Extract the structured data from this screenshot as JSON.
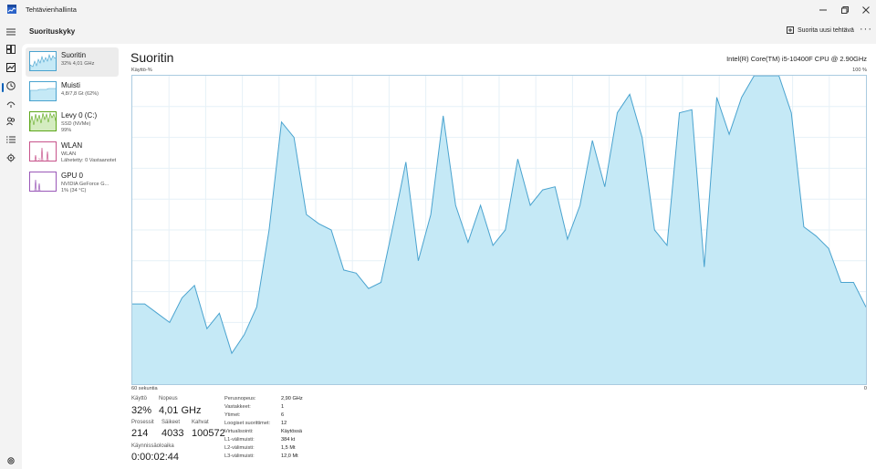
{
  "window": {
    "title": "Tehtävienhallinta",
    "minimize_icon": "minimize-icon",
    "maximize_icon": "restore-icon",
    "close_icon": "close-icon"
  },
  "header": {
    "section_title": "Suorituskyky",
    "run_task_label": "Suorita uusi tehtävä",
    "more_label": "···"
  },
  "rail": {
    "items": [
      {
        "icon": "hamburger-menu-icon"
      },
      {
        "icon": "processes-icon"
      },
      {
        "icon": "performance-icon"
      },
      {
        "icon": "app-history-icon"
      },
      {
        "icon": "startup-apps-icon"
      },
      {
        "icon": "users-icon"
      },
      {
        "icon": "details-icon"
      },
      {
        "icon": "services-icon"
      },
      {
        "icon": "settings-gear-icon"
      }
    ],
    "accent_color": "#005fb8"
  },
  "devices": [
    {
      "name": "Suoritin",
      "sub": "32% 4,01 GHz",
      "sub2": "",
      "color": "#4aa3cf"
    },
    {
      "name": "Muisti",
      "sub": "4,8/7,8 Gt (62%)",
      "sub2": "",
      "color": "#4aa3cf"
    },
    {
      "name": "Levy 0 (C:)",
      "sub": "SSD (NVMe)",
      "sub2": "99%",
      "color": "#5da71a"
    },
    {
      "name": "WLAN",
      "sub": "WLAN",
      "sub2": "Lähetetty: 0 Vastaanotet",
      "color": "#c7538b"
    },
    {
      "name": "GPU 0",
      "sub": "NVIDIA GeForce G...",
      "sub2": "1% (34 °C)",
      "color": "#9a58b8"
    }
  ],
  "perf": {
    "title": "Suoritin",
    "cpu_model": "Intel(R) Core(TM) i5-10400F CPU @ 2.90GHz",
    "y_axis_label": "Käyttö-%",
    "y_max_label": "100 %",
    "x_left_label": "60 sekuntia",
    "x_right_label": "0"
  },
  "chart_data": {
    "type": "area",
    "ylim": [
      0,
      100
    ],
    "grid": true,
    "color": "#4aa3cf",
    "fill": "#c5e9f6",
    "x": [
      0,
      1,
      2,
      3,
      4,
      5,
      6,
      7,
      8,
      9,
      10,
      11,
      12,
      13,
      14,
      15,
      16,
      17,
      18,
      19,
      20,
      21,
      22,
      23,
      24,
      25,
      26,
      27,
      28,
      29,
      30,
      31,
      32,
      33,
      34,
      35,
      36,
      37,
      38,
      39,
      40,
      41,
      42,
      43,
      44,
      45,
      46,
      47,
      48,
      49,
      50,
      51,
      52,
      53,
      54,
      55,
      56,
      57,
      58,
      59
    ],
    "values": [
      26,
      26,
      23,
      20,
      28,
      32,
      18,
      23,
      10,
      16,
      25,
      50,
      85,
      80,
      55,
      52,
      50,
      37,
      36,
      31,
      33,
      52,
      72,
      40,
      55,
      87,
      58,
      46,
      58,
      45,
      50,
      73,
      58,
      63,
      64,
      47,
      58,
      79,
      64,
      88,
      94,
      80,
      50,
      45,
      88,
      89,
      38,
      93,
      81,
      93,
      100,
      100,
      100,
      88,
      51,
      48,
      44,
      33,
      33,
      25
    ],
    "x_range_label": "60 sekuntia"
  },
  "stats": {
    "usage_label": "Käyttö",
    "usage_value": "32%",
    "speed_label": "Nopeus",
    "speed_value": "4,01 GHz",
    "processes_label": "Prosessit",
    "processes_value": "214",
    "threads_label": "Säikeet",
    "threads_value": "4033",
    "handles_label": "Kahvat",
    "handles_value": "100572",
    "uptime_label": "Käynnissäoloaika",
    "uptime_value": "0:00:02:44",
    "details": [
      {
        "k": "Perusnopeus:",
        "v": "2,90 GHz"
      },
      {
        "k": "Vastakkeet:",
        "v": "1"
      },
      {
        "k": "Ytimet:",
        "v": "6"
      },
      {
        "k": "Loogiset suorittimet:",
        "v": "12"
      },
      {
        "k": "Virtualisointi:",
        "v": "Käytössä"
      },
      {
        "k": "L1-välimuisti:",
        "v": "384 kt"
      },
      {
        "k": "L2-välimuisti:",
        "v": "1,5 Mt"
      },
      {
        "k": "L3-välimuisti:",
        "v": "12,0 Mt"
      }
    ]
  }
}
